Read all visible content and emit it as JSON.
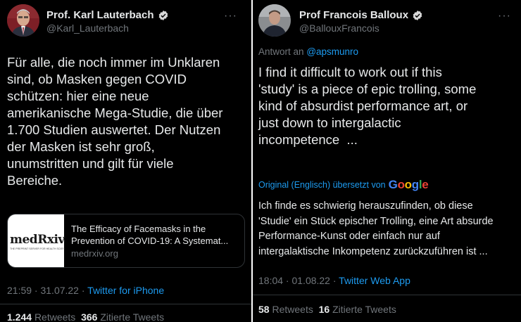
{
  "left_tweet": {
    "author_name": "Prof. Karl Lauterbach",
    "handle": "@Karl_Lauterbach",
    "text_lines": [
      "Für alle, die noch immer im Unklaren",
      "sind, ob Masken gegen COVID",
      "schützen: hier eine neue",
      "amerikanische Mega-Studie, die über",
      "1.700 Studien auswertet. Der Nutzen",
      "der Masken ist sehr groß,",
      "unumstritten und gilt für viele",
      "Bereiche."
    ],
    "card": {
      "logo_text": "medRxiv",
      "logo_tagline": "THE PREPRINT SERVER FOR HEALTH SCIENCES",
      "title_line1": "The Efficacy of Facemasks in the",
      "title_line2": "Prevention of COVID-19: A Systemat...",
      "domain": "medrxiv.org"
    },
    "time": "21:59 · 31.07.22 ·",
    "source": "Twitter for iPhone",
    "retweets_count": "1.244",
    "retweets_label": "Retweets",
    "quotes_count": "366",
    "quotes_label": "Zitierte Tweets",
    "more_icon": "···"
  },
  "right_tweet": {
    "author_name": "Prof Francois Balloux",
    "handle": "@BallouxFrancois",
    "reply_prefix": "Antwort an",
    "reply_handle": "@apsmunro",
    "text_lines": [
      "I find it difficult to work out if this",
      "'study' is a piece of epic trolling, some",
      "kind of absurdist performance art, or",
      "just down to intergalactic",
      "incompetence  ..."
    ],
    "translated_label": "Original (Englisch) übersetzt von",
    "translator": "Google",
    "translation_lines": [
      "Ich finde es schwierig herauszufinden, ob diese",
      "'Studie' ein Stück epischer Trolling, eine Art absurde",
      "Performance-Kunst oder einfach nur auf",
      "intergalaktische Inkompetenz zurückzuführen ist ..."
    ],
    "time": "18:04 · 01.08.22 ·",
    "source": "Twitter Web App",
    "retweets_count": "58",
    "retweets_label": "Retweets",
    "quotes_count": "16",
    "quotes_label": "Zitierte Tweets",
    "more_icon": "···"
  },
  "colors": {
    "background": "#000000",
    "text": "#e7e9ea",
    "secondary": "#71767b",
    "link": "#1d9bf0",
    "verified": "#d9d9d9",
    "divider": "#ffffff"
  }
}
